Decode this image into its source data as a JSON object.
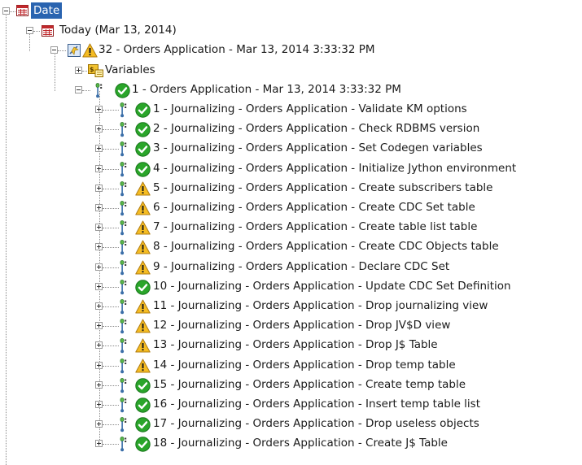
{
  "tree": {
    "root": {
      "label": "Date",
      "icon": "calendar-icon",
      "selected": true,
      "expanded": true
    },
    "day": {
      "label": "Today (Mar 13, 2014)",
      "icon": "calendar-icon",
      "expanded": true
    },
    "session": {
      "label": "32 - Orders Application - Mar 13, 2014 3:33:32 PM",
      "icons": [
        "session-icon",
        "warning-icon"
      ],
      "expanded": true
    },
    "variables": {
      "label": "Variables",
      "icon": "variables-icon",
      "expanded": false
    },
    "step": {
      "label": "1 - Orders Application - Mar 13, 2014 3:33:32 PM",
      "icons": [
        "step-icon",
        "success-icon"
      ],
      "expanded": true
    },
    "tasks": [
      {
        "label": "1 - Journalizing - Orders Application - Validate KM options",
        "status": "success"
      },
      {
        "label": "2 - Journalizing - Orders Application - Check RDBMS version",
        "status": "success"
      },
      {
        "label": "3 - Journalizing - Orders Application - Set Codegen variables",
        "status": "success"
      },
      {
        "label": "4 - Journalizing - Orders Application - Initialize Jython environment",
        "status": "success"
      },
      {
        "label": "5 - Journalizing - Orders Application - Create subscribers table",
        "status": "warning"
      },
      {
        "label": "6 - Journalizing - Orders Application - Create CDC Set table",
        "status": "warning"
      },
      {
        "label": "7 - Journalizing - Orders Application - Create table list table",
        "status": "warning"
      },
      {
        "label": "8 - Journalizing - Orders Application - Create CDC Objects table",
        "status": "warning"
      },
      {
        "label": "9 - Journalizing - Orders Application - Declare CDC Set",
        "status": "warning"
      },
      {
        "label": "10 - Journalizing - Orders Application - Update CDC Set Definition",
        "status": "success"
      },
      {
        "label": "11 - Journalizing - Orders Application - Drop journalizing view",
        "status": "warning"
      },
      {
        "label": "12 - Journalizing - Orders Application - Drop JV$D view",
        "status": "warning"
      },
      {
        "label": "13 - Journalizing - Orders Application - Drop J$ Table",
        "status": "warning"
      },
      {
        "label": "14 - Journalizing - Orders Application - Drop temp table",
        "status": "warning"
      },
      {
        "label": "15 - Journalizing - Orders Application - Create temp table",
        "status": "success"
      },
      {
        "label": "16 - Journalizing - Orders Application - Insert temp table list",
        "status": "success"
      },
      {
        "label": "17 - Journalizing - Orders Application - Drop useless objects",
        "status": "success"
      },
      {
        "label": "18 - Journalizing - Orders Application - Create J$ Table",
        "status": "success"
      }
    ]
  },
  "colors": {
    "selection": "#2a64b0",
    "success": "#2aa52a",
    "warning": "#f2b21b",
    "calendar": "#c0282c"
  }
}
